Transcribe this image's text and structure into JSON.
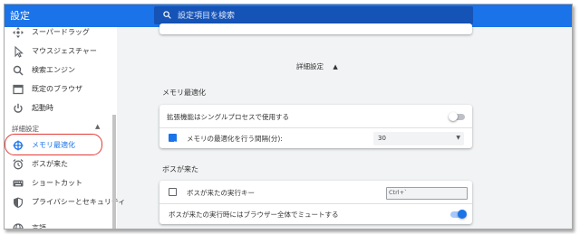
{
  "header": {
    "title": "設定",
    "search_placeholder": "設定項目を検索"
  },
  "sidebar": {
    "items": [
      {
        "label": "スーパードラッグ",
        "icon": "drag-arrows-icon"
      },
      {
        "label": "マウスジェスチャー",
        "icon": "cursor-icon"
      },
      {
        "label": "検索エンジン",
        "icon": "search-icon"
      },
      {
        "label": "既定のブラウザ",
        "icon": "browser-icon"
      },
      {
        "label": "起動時",
        "icon": "power-icon"
      }
    ],
    "section_label": "詳細設定",
    "sub_items": [
      {
        "label": "メモリ最適化",
        "icon": "memory-target-icon",
        "active": true
      },
      {
        "label": "ボスが来た",
        "icon": "alarm-clock-icon"
      },
      {
        "label": "ショートカット",
        "icon": "keyboard-icon"
      },
      {
        "label": "プライバシーとセキュリティ",
        "icon": "shield-icon"
      },
      {
        "label": "言語",
        "icon": "globe-icon"
      }
    ]
  },
  "main": {
    "advanced_label": "詳細設定",
    "memory_section": {
      "title": "メモリ最適化",
      "rows": {
        "single_process": {
          "label": "拡張機能はシングルプロセスで使用する",
          "enabled": false
        },
        "interval": {
          "label": "メモリの最適化を行う間隔(分):",
          "checked": true,
          "value": "30"
        }
      }
    },
    "boss_section": {
      "title": "ボスが来た",
      "rows": {
        "hotkey": {
          "label": "ボスが来たの実行キー",
          "checked": false,
          "value": "Ctrl+`"
        },
        "mute": {
          "label": "ボスが来たの実行時にはブラウザー全体でミュートする",
          "enabled": true
        }
      }
    }
  },
  "colors": {
    "accent": "#1a73e8",
    "highlight_circle": "#e53935",
    "background": "#f1f3f4"
  }
}
